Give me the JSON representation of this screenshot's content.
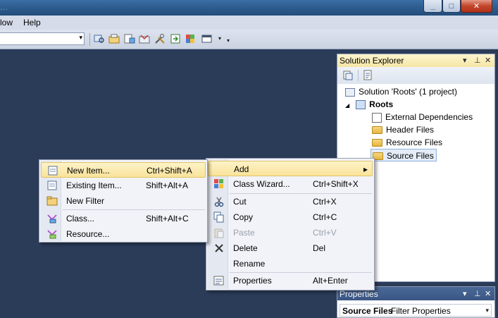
{
  "window": {
    "title": "...",
    "buttons": {
      "minimize": "_",
      "maximize": "□",
      "close": "✕"
    }
  },
  "menubar": {
    "items": [
      "low",
      "Help"
    ]
  },
  "toolbar": {
    "combo_arrow": "▾",
    "icons": [
      "find-in-files-icon",
      "project-icon",
      "class-view-icon",
      "toolbox-icon",
      "tools-icon",
      "solution-explorer-icon",
      "properties-icon",
      "window-icon",
      "overflow-icon"
    ]
  },
  "solution_explorer": {
    "title": "Solution Explorer",
    "header_icons": {
      "dropdown": "▾",
      "pin": "⊥",
      "close": "✕"
    },
    "tree": [
      {
        "label": "Solution 'Roots' (1 project)",
        "icon": "solution-icon"
      },
      {
        "label": "Roots",
        "icon": "project-icon",
        "bold": true,
        "expander": "◢"
      },
      {
        "label": "External Dependencies",
        "icon": "dependencies-icon"
      },
      {
        "label": "Header Files",
        "icon": "folder-icon"
      },
      {
        "label": "Resource Files",
        "icon": "folder-icon"
      },
      {
        "label": "Source Files",
        "icon": "folder-icon",
        "selected": true
      }
    ]
  },
  "properties": {
    "title": "Properties",
    "header_icons": {
      "dropdown": "▾",
      "pin": "⊥",
      "close": "✕"
    },
    "object_name": "Source Files",
    "object_type": "Filter Properties",
    "arrow": "▾"
  },
  "context_menu": {
    "items": [
      {
        "label": "Add",
        "submenu_arrow": "▸",
        "highlighted": true
      },
      {
        "label": "Class Wizard...",
        "shortcut": "Ctrl+Shift+X",
        "icon": "class-wizard-icon"
      },
      {
        "label": "Cut",
        "shortcut": "Ctrl+X",
        "icon": "cut-icon"
      },
      {
        "label": "Copy",
        "shortcut": "Ctrl+C",
        "icon": "copy-icon"
      },
      {
        "label": "Paste",
        "shortcut": "Ctrl+V",
        "icon": "paste-icon",
        "disabled": true
      },
      {
        "label": "Delete",
        "shortcut": "Del",
        "icon": "delete-icon"
      },
      {
        "label": "Rename",
        "shortcut": ""
      },
      {
        "label": "Properties",
        "shortcut": "Alt+Enter",
        "icon": "properties-icon"
      }
    ]
  },
  "submenu": {
    "items": [
      {
        "label": "New Item...",
        "shortcut": "Ctrl+Shift+A",
        "icon": "new-item-icon",
        "highlighted": true
      },
      {
        "label": "Existing Item...",
        "shortcut": "Shift+Alt+A",
        "icon": "existing-item-icon"
      },
      {
        "label": "New Filter",
        "shortcut": "",
        "icon": "folder-icon"
      },
      {
        "label": "Class...",
        "shortcut": "Shift+Alt+C",
        "icon": "class-icon"
      },
      {
        "label": "Resource...",
        "shortcut": "",
        "icon": "resource-icon"
      }
    ]
  },
  "colors": {
    "workspace": "#2b3c59",
    "highlight": "#f9e39a",
    "pane_header": "#f5e6a4"
  }
}
